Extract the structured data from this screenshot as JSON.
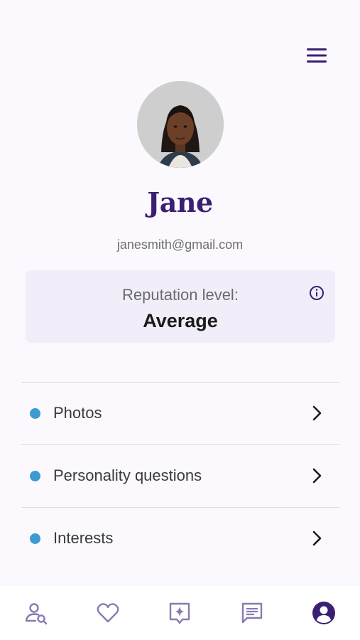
{
  "header": {
    "menu_icon": "hamburger-menu-icon"
  },
  "profile": {
    "avatar_icon": "profile-photo",
    "name": "Jane",
    "email": "janesmith@gmail.com"
  },
  "reputation": {
    "label": "Reputation level:",
    "value": "Average",
    "info_icon": "info-icon"
  },
  "sections": [
    {
      "label": "Photos",
      "status_color": "#3d9ad1"
    },
    {
      "label": "Personality questions",
      "status_color": "#3d9ad1"
    },
    {
      "label": "Interests",
      "status_color": "#3d9ad1"
    }
  ],
  "bottom_nav": {
    "items": [
      {
        "icon": "people-search-icon"
      },
      {
        "icon": "heart-icon"
      },
      {
        "icon": "sparkle-chat-icon"
      },
      {
        "icon": "message-icon"
      },
      {
        "icon": "profile-icon",
        "active": true
      }
    ]
  },
  "colors": {
    "accent": "#3b1f72",
    "status_dot": "#3d9ad1",
    "background": "#fbf9fe"
  }
}
